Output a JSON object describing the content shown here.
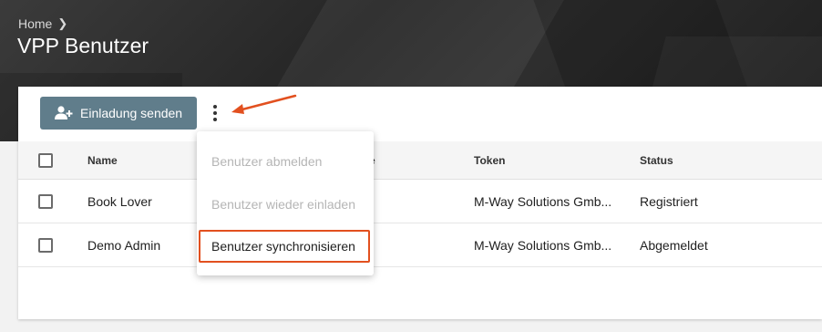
{
  "header": {
    "breadcrumb": "Home",
    "title": "VPP Benutzer"
  },
  "toolbar": {
    "invite_label": "Einladung senden",
    "invite_icon": "person-add-icon",
    "more_icon": "more-vertical-icon"
  },
  "table": {
    "columns": {
      "name": "Name",
      "hidden_partial": "e",
      "token": "Token",
      "status": "Status"
    },
    "rows": [
      {
        "name": "Book Lover",
        "token": "M-Way Solutions Gmb...",
        "status": "Registriert"
      },
      {
        "name": "Demo Admin",
        "token": "M-Way Solutions Gmb...",
        "status": "Abgemeldet"
      }
    ]
  },
  "menu": {
    "items": [
      {
        "label": "Benutzer abmelden",
        "enabled": false
      },
      {
        "label": "Benutzer wieder einladen",
        "enabled": false
      },
      {
        "label": "Benutzer synchronisieren",
        "enabled": true
      }
    ]
  },
  "colors": {
    "accent_button": "#607d8b",
    "annotation": "#e2501f"
  }
}
